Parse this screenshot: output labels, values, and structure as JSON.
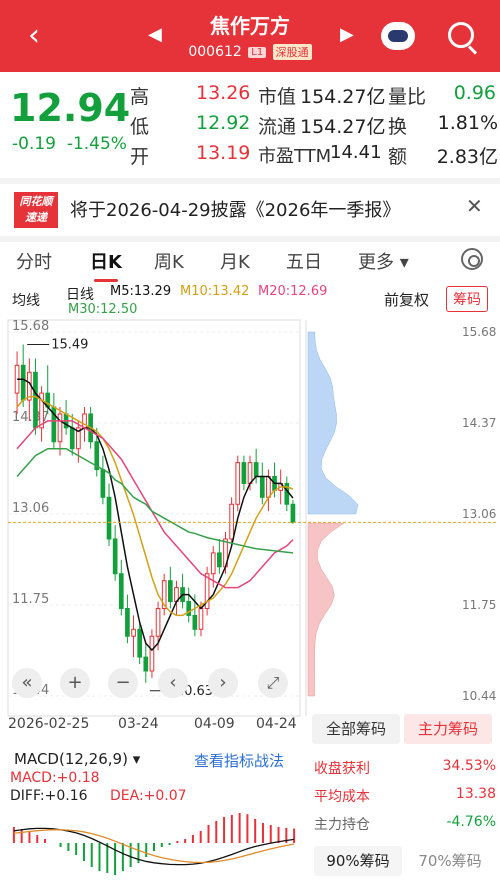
{
  "header": {
    "title": "焦作万方",
    "code": "000612",
    "tag_level": "L1",
    "tag_market": "深股通",
    "back_icon": "back-chevron-icon",
    "robot_icon": "assistant-robot-icon",
    "search_icon": "search-icon"
  },
  "quote": {
    "price": "12.94",
    "change": "-0.19",
    "change_pct": "-1.45%",
    "high_label": "高",
    "high": "13.26",
    "low_label": "低",
    "low": "12.92",
    "open_label": "开",
    "open": "13.19",
    "mktcap_label": "市值",
    "mktcap": "154.27亿",
    "float_label": "流通",
    "float": "154.27亿",
    "pe_label": "市盈TTM",
    "pe": "14.41",
    "volratio_label": "量比",
    "volratio": "0.96",
    "turnover_label": "换",
    "turnover": "1.81%",
    "amount_label": "额",
    "amount": "2.83亿"
  },
  "notice": {
    "logo_line1": "同花顺",
    "logo_line2": "速递",
    "text": "将于2026-04-29披露《2026年一季报》"
  },
  "tabs": [
    "分时",
    "日K",
    "周K",
    "月K",
    "五日",
    "更多 ▾"
  ],
  "active_tab": "日K",
  "ma": {
    "select": "均线",
    "period": "日线",
    "m5": "M5:13.29",
    "m10": "M10:13.42",
    "m20": "M20:12.69",
    "m30": "M30:12.50",
    "adjust": "前复权",
    "chip": "筹码",
    "colors": {
      "m5": "#111111",
      "m10": "#d4a017",
      "m20": "#e6457a",
      "m30": "#35a04a"
    }
  },
  "chart_data": {
    "type": "candlestick",
    "y_ticks": [
      "15.68",
      "14.37",
      "13.06",
      "11.75",
      "10.44"
    ],
    "max_label": "15.49",
    "min_label": "10.63",
    "x_ticks": [
      "2026-02-25",
      "03-24",
      "04-09",
      "04-24"
    ],
    "price_range": [
      10.44,
      15.68
    ],
    "candles": [
      [
        14.8,
        15.4,
        14.5,
        15.2
      ],
      [
        15.2,
        15.5,
        14.6,
        14.7
      ],
      [
        14.7,
        15.3,
        14.4,
        15.1
      ],
      [
        15.1,
        15.3,
        14.2,
        14.3
      ],
      [
        14.3,
        14.9,
        14.1,
        14.8
      ],
      [
        14.8,
        15.2,
        14.5,
        14.6
      ],
      [
        14.6,
        14.8,
        14.0,
        14.1
      ],
      [
        14.1,
        14.6,
        13.9,
        14.5
      ],
      [
        14.5,
        14.7,
        14.2,
        14.3
      ],
      [
        14.3,
        14.5,
        13.9,
        14.0
      ],
      [
        14.0,
        14.4,
        13.8,
        14.3
      ],
      [
        14.3,
        14.6,
        14.1,
        14.5
      ],
      [
        14.5,
        14.6,
        14.0,
        14.1
      ],
      [
        14.1,
        14.3,
        13.6,
        13.7
      ],
      [
        13.7,
        13.9,
        13.2,
        13.3
      ],
      [
        13.3,
        13.5,
        12.6,
        12.7
      ],
      [
        12.7,
        12.9,
        12.1,
        12.2
      ],
      [
        12.2,
        12.4,
        11.6,
        11.7
      ],
      [
        11.7,
        11.9,
        11.2,
        11.3
      ],
      [
        11.3,
        11.6,
        11.0,
        11.4
      ],
      [
        11.4,
        11.5,
        10.9,
        11.0
      ],
      [
        11.0,
        11.2,
        10.63,
        10.8
      ],
      [
        10.8,
        11.4,
        10.7,
        11.3
      ],
      [
        11.3,
        11.8,
        11.1,
        11.7
      ],
      [
        11.7,
        12.2,
        11.6,
        12.1
      ],
      [
        12.1,
        12.3,
        11.7,
        11.8
      ],
      [
        11.8,
        12.1,
        11.6,
        12.0
      ],
      [
        12.0,
        12.2,
        11.7,
        11.8
      ],
      [
        11.8,
        12.0,
        11.5,
        11.6
      ],
      [
        11.6,
        11.9,
        11.3,
        11.4
      ],
      [
        11.4,
        11.8,
        11.3,
        11.7
      ],
      [
        11.7,
        12.3,
        11.6,
        12.2
      ],
      [
        12.2,
        12.6,
        12.0,
        12.5
      ],
      [
        12.5,
        12.7,
        12.2,
        12.3
      ],
      [
        12.3,
        12.8,
        12.2,
        12.7
      ],
      [
        12.7,
        13.3,
        12.6,
        13.2
      ],
      [
        13.2,
        13.9,
        13.1,
        13.8
      ],
      [
        13.8,
        13.9,
        13.4,
        13.5
      ],
      [
        13.5,
        13.9,
        13.4,
        13.8
      ],
      [
        13.8,
        14.0,
        13.5,
        13.6
      ],
      [
        13.6,
        13.8,
        13.2,
        13.3
      ],
      [
        13.3,
        13.7,
        13.1,
        13.6
      ],
      [
        13.6,
        13.8,
        13.3,
        13.4
      ],
      [
        13.4,
        13.7,
        13.2,
        13.5
      ],
      [
        13.5,
        13.6,
        13.1,
        13.2
      ],
      [
        13.2,
        13.26,
        12.92,
        12.94
      ]
    ],
    "ma5": [
      15.0,
      15.0,
      14.95,
      14.8,
      14.7,
      14.6,
      14.5,
      14.4,
      14.35,
      14.3,
      14.25,
      14.3,
      14.3,
      14.2,
      14.0,
      13.7,
      13.3,
      12.8,
      12.3,
      11.9,
      11.5,
      11.2,
      11.1,
      11.2,
      11.4,
      11.6,
      11.8,
      11.9,
      11.9,
      11.8,
      11.7,
      11.8,
      11.9,
      12.1,
      12.3,
      12.6,
      13.0,
      13.3,
      13.5,
      13.6,
      13.6,
      13.6,
      13.5,
      13.5,
      13.4,
      13.29
    ],
    "ma10": [
      14.6,
      14.7,
      14.75,
      14.75,
      14.7,
      14.65,
      14.6,
      14.55,
      14.5,
      14.45,
      14.4,
      14.35,
      14.3,
      14.25,
      14.15,
      14.0,
      13.8,
      13.55,
      13.3,
      13.05,
      12.75,
      12.45,
      12.15,
      11.9,
      11.75,
      11.65,
      11.6,
      11.6,
      11.65,
      11.7,
      11.75,
      11.8,
      11.85,
      11.95,
      12.05,
      12.2,
      12.4,
      12.6,
      12.8,
      13.0,
      13.15,
      13.3,
      13.4,
      13.45,
      13.45,
      13.42
    ],
    "ma20": [
      14.0,
      14.1,
      14.2,
      14.3,
      14.35,
      14.4,
      14.4,
      14.4,
      14.4,
      14.4,
      14.35,
      14.3,
      14.25,
      14.2,
      14.15,
      14.05,
      13.95,
      13.85,
      13.7,
      13.55,
      13.4,
      13.25,
      13.1,
      12.95,
      12.8,
      12.7,
      12.6,
      12.5,
      12.4,
      12.3,
      12.2,
      12.15,
      12.1,
      12.05,
      12.0,
      12.0,
      12.0,
      12.05,
      12.1,
      12.2,
      12.3,
      12.4,
      12.5,
      12.55,
      12.6,
      12.69
    ],
    "ma30": [
      13.6,
      13.7,
      13.8,
      13.9,
      13.95,
      14.0,
      14.0,
      14.0,
      14.0,
      13.95,
      13.9,
      13.85,
      13.8,
      13.75,
      13.7,
      13.65,
      13.55,
      13.5,
      13.4,
      13.3,
      13.25,
      13.2,
      13.1,
      13.05,
      13.0,
      12.95,
      12.9,
      12.85,
      12.8,
      12.78,
      12.75,
      12.72,
      12.7,
      12.68,
      12.66,
      12.64,
      12.62,
      12.6,
      12.58,
      12.56,
      12.55,
      12.54,
      12.53,
      12.52,
      12.51,
      12.5
    ]
  },
  "chart_controls": [
    "«",
    "+",
    "−",
    "‹",
    "›",
    "⤢"
  ],
  "chip_tabs": {
    "all": "全部筹码",
    "main": "主力筹码"
  },
  "macd": {
    "title": "MACD(12,26,9) ▾",
    "link": "查看指标战法",
    "macd_val": "MACD:+0.18",
    "diff": "DIFF:+0.16",
    "dea": "DEA:+0.07",
    "bars": [
      0.4,
      0.35,
      0.3,
      0.2,
      0.1,
      0.0,
      -0.1,
      -0.2,
      -0.3,
      -0.45,
      -0.6,
      -0.7,
      -0.75,
      -0.8,
      -0.7,
      -0.6,
      -0.5,
      -0.35,
      -0.2,
      -0.1,
      -0.05,
      0.05,
      0.1,
      0.2,
      0.3,
      0.45,
      0.55,
      0.65,
      0.7,
      0.75,
      0.72,
      0.6,
      0.5,
      0.45,
      0.4,
      0.38,
      0.36
    ]
  },
  "chip_stats": {
    "profit_label": "收盘获利",
    "profit": "34.53%",
    "avg_label": "平均成本",
    "avg": "13.38",
    "control_label": "主力持仓",
    "control": "-4.76%",
    "c90": "90%筹码",
    "c70": "70%筹码"
  }
}
